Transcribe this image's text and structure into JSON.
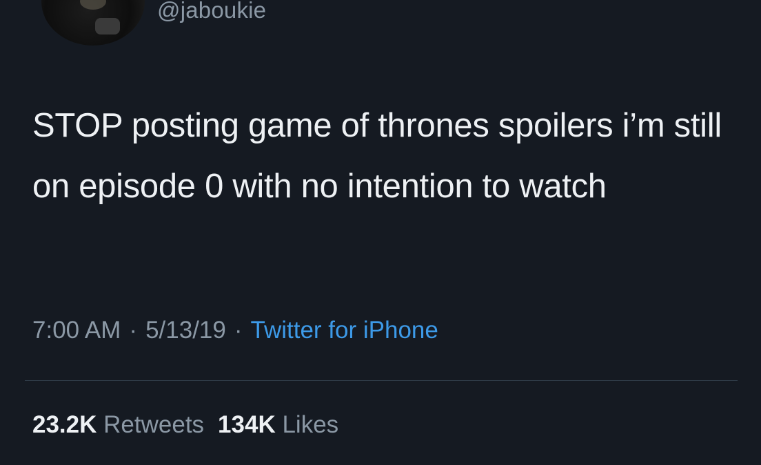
{
  "tweet": {
    "handle": "@jaboukie",
    "text": "STOP posting game of thrones spoilers i’m still on episode 0 with no intention to watch",
    "time": "7:00 AM",
    "date": "5/13/19",
    "separator": "·",
    "source": "Twitter for iPhone",
    "retweet_count": "23.2K",
    "retweet_label": "Retweets",
    "like_count": "134K",
    "like_label": "Likes"
  },
  "colors": {
    "background": "#151a22",
    "link": "#3d9ae8",
    "secondary_text": "#8b98a5",
    "primary_text": "#eef1f4"
  }
}
